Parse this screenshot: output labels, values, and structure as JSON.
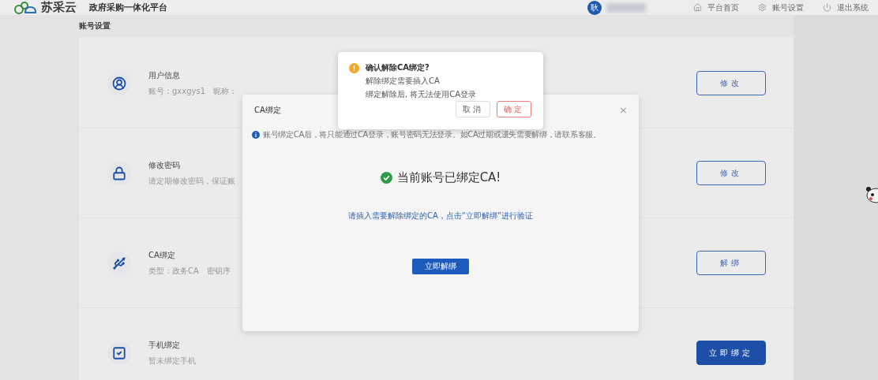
{
  "header": {
    "logo_text": "苏采云",
    "platform_title": "政府采购一体化平台",
    "user": {
      "avatar": "耿"
    },
    "nav": [
      {
        "kind": "home",
        "label": "平台首页"
      },
      {
        "kind": "settings",
        "label": "账号设置"
      },
      {
        "kind": "logout",
        "label": "退出系统"
      }
    ]
  },
  "page_title": "账号设置",
  "settings": [
    {
      "kind": "user",
      "title": "用户信息",
      "details": [
        "账号：gxxgys1",
        "昵称："
      ],
      "button": {
        "label": "修改",
        "primary": false
      }
    },
    {
      "kind": "lock",
      "title": "修改密码",
      "details": [
        "请定期修改密码，保证账"
      ],
      "button": {
        "label": "修改",
        "primary": false
      }
    },
    {
      "kind": "key",
      "title": "CA绑定",
      "details": [
        "类型：政务CA",
        "密钥序"
      ],
      "button": {
        "label": "解绑",
        "primary": false
      }
    },
    {
      "kind": "phone",
      "title": "手机绑定",
      "details": [
        "暂未绑定手机"
      ],
      "button": {
        "label": "立即绑定",
        "primary": true
      }
    }
  ],
  "modal": {
    "title": "CA绑定",
    "close": "×",
    "notice": "账号绑定CA后，将只能通过CA登录，账号密码无法登录。如CA过期或遗失需要解绑，请联系客服。",
    "status": "当前账号已绑定CA!",
    "hint": "请插入需要解除绑定的CA，点击“立即解绑”进行验证",
    "action_button": "立即解绑"
  },
  "confirm": {
    "title": "确认解除CA绑定?",
    "lines": [
      "解除绑定需要插入CA",
      "绑定解除后, 将无法使用CA登录"
    ],
    "buttons": [
      {
        "kind": "cancel",
        "label": "取消"
      },
      {
        "kind": "confirm",
        "label": "确定"
      }
    ]
  }
}
